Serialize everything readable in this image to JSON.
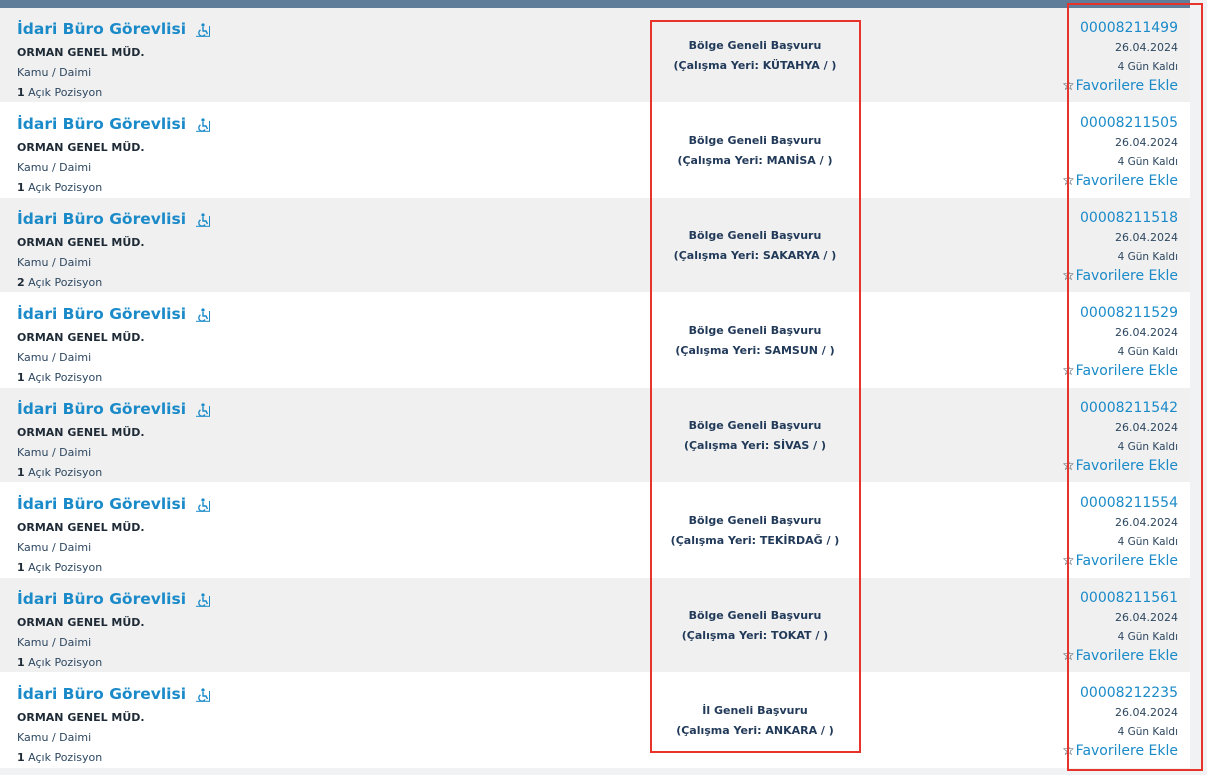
{
  "colors": {
    "header_bar": "#5f7d98",
    "link_blue": "#1a8ac9",
    "dark_navy": "#223a59",
    "highlight_red": "#e8332a"
  },
  "listings": [
    {
      "title": "İdari Büro Görevlisi",
      "org": "ORMAN GENEL MÜD.",
      "type": "Kamu / Daimi",
      "positions": "1",
      "positions_label": "Açık Pozisyon",
      "scope": "Bölge Geneli Başvuru",
      "location": "(Çalışma Yeri: KÜTAHYA / )",
      "ilan_no": "00008211499",
      "date": "26.04.2024",
      "remaining": "4 Gün Kaldı",
      "fav_label": "Favorilere Ekle"
    },
    {
      "title": "İdari Büro Görevlisi",
      "org": "ORMAN GENEL MÜD.",
      "type": "Kamu / Daimi",
      "positions": "1",
      "positions_label": "Açık Pozisyon",
      "scope": "Bölge Geneli Başvuru",
      "location": "(Çalışma Yeri: MANİSA / )",
      "ilan_no": "00008211505",
      "date": "26.04.2024",
      "remaining": "4 Gün Kaldı",
      "fav_label": "Favorilere Ekle"
    },
    {
      "title": "İdari Büro Görevlisi",
      "org": "ORMAN GENEL MÜD.",
      "type": "Kamu / Daimi",
      "positions": "2",
      "positions_label": "Açık Pozisyon",
      "scope": "Bölge Geneli Başvuru",
      "location": "(Çalışma Yeri: SAKARYA / )",
      "ilan_no": "00008211518",
      "date": "26.04.2024",
      "remaining": "4 Gün Kaldı",
      "fav_label": "Favorilere Ekle"
    },
    {
      "title": "İdari Büro Görevlisi",
      "org": "ORMAN GENEL MÜD.",
      "type": "Kamu / Daimi",
      "positions": "1",
      "positions_label": "Açık Pozisyon",
      "scope": "Bölge Geneli Başvuru",
      "location": "(Çalışma Yeri: SAMSUN / )",
      "ilan_no": "00008211529",
      "date": "26.04.2024",
      "remaining": "4 Gün Kaldı",
      "fav_label": "Favorilere Ekle"
    },
    {
      "title": "İdari Büro Görevlisi",
      "org": "ORMAN GENEL MÜD.",
      "type": "Kamu / Daimi",
      "positions": "1",
      "positions_label": "Açık Pozisyon",
      "scope": "Bölge Geneli Başvuru",
      "location": "(Çalışma Yeri: SİVAS / )",
      "ilan_no": "00008211542",
      "date": "26.04.2024",
      "remaining": "4 Gün Kaldı",
      "fav_label": "Favorilere Ekle"
    },
    {
      "title": "İdari Büro Görevlisi",
      "org": "ORMAN GENEL MÜD.",
      "type": "Kamu / Daimi",
      "positions": "1",
      "positions_label": "Açık Pozisyon",
      "scope": "Bölge Geneli Başvuru",
      "location": "(Çalışma Yeri: TEKİRDAĞ / )",
      "ilan_no": "00008211554",
      "date": "26.04.2024",
      "remaining": "4 Gün Kaldı",
      "fav_label": "Favorilere Ekle"
    },
    {
      "title": "İdari Büro Görevlisi",
      "org": "ORMAN GENEL MÜD.",
      "type": "Kamu / Daimi",
      "positions": "1",
      "positions_label": "Açık Pozisyon",
      "scope": "Bölge Geneli Başvuru",
      "location": "(Çalışma Yeri: TOKAT / )",
      "ilan_no": "00008211561",
      "date": "26.04.2024",
      "remaining": "4 Gün Kaldı",
      "fav_label": "Favorilere Ekle"
    },
    {
      "title": "İdari Büro Görevlisi",
      "org": "ORMAN GENEL MÜD.",
      "type": "Kamu / Daimi",
      "positions": "1",
      "positions_label": "Açık Pozisyon",
      "scope": "İl Geneli Başvuru",
      "location": "(Çalışma Yeri: ANKARA / )",
      "ilan_no": "00008212235",
      "date": "26.04.2024",
      "remaining": "4 Gün Kaldı",
      "fav_label": "Favorilere Ekle"
    }
  ]
}
